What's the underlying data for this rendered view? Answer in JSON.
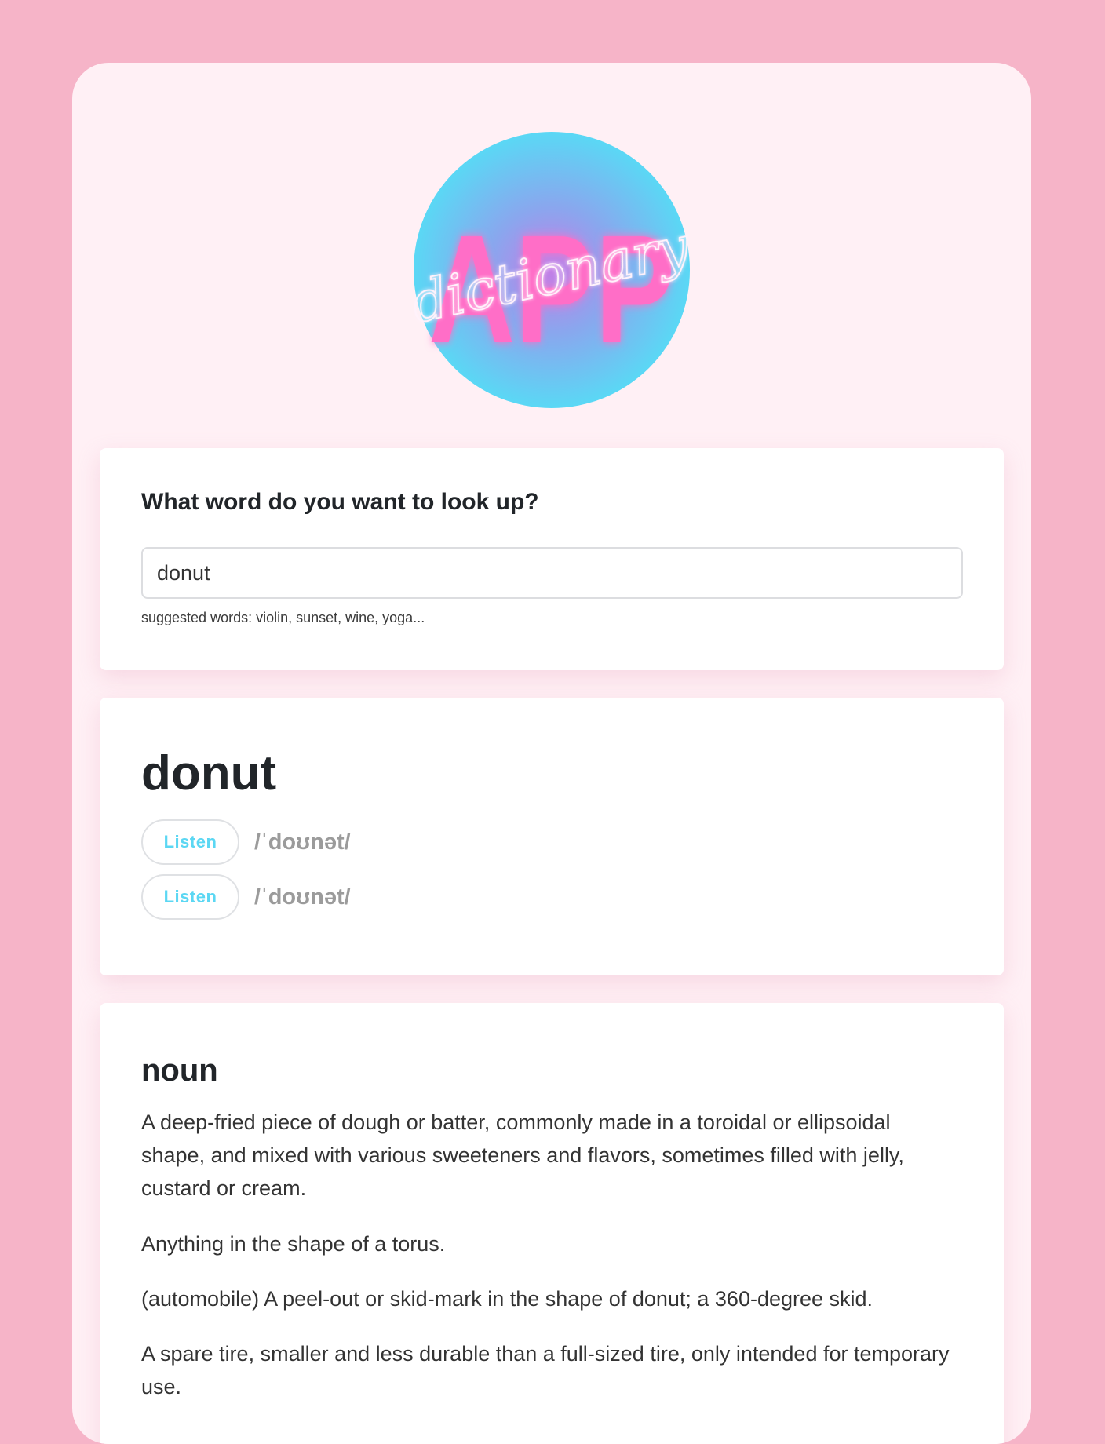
{
  "logo": {
    "big_text": "APP",
    "script_text": "dictionary"
  },
  "search": {
    "heading": "What word do you want to look up?",
    "value": "donut",
    "hint": "suggested words: violin, sunset, wine, yoga..."
  },
  "word": {
    "title": "donut",
    "phonetics": [
      {
        "button_label": "Listen",
        "text": "/ˈdoʊnət/"
      },
      {
        "button_label": "Listen",
        "text": "/ˈdoʊnət/"
      }
    ]
  },
  "meaning": {
    "part_of_speech": "noun",
    "definitions": [
      "A deep-fried piece of dough or batter, commonly made in a toroidal or ellipsoidal shape, and mixed with various sweeteners and flavors, sometimes filled with jelly, custard or cream.",
      "Anything in the shape of a torus.",
      "(automobile) A peel-out or skid-mark in the shape of donut; a 360-degree skid.",
      "A spare tire, smaller and less durable than a full-sized tire, only intended for temporary use."
    ]
  },
  "colors": {
    "page_background": "#f6b4c8",
    "container_background": "#fff0f5",
    "accent_blue": "#5bd7f3",
    "logo_pink": "#ff6ec7"
  }
}
